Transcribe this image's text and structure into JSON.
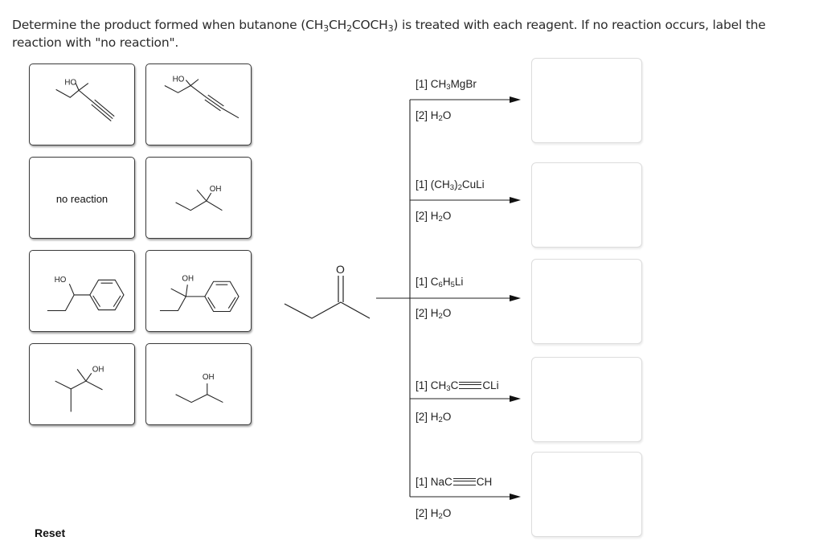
{
  "instructions": {
    "part1": "Determine the product formed when butanone (CH",
    "sub1": "3",
    "part2": "CH",
    "sub2": "2",
    "part3": "COCH",
    "sub3": "3",
    "part4": ") is treated with each reagent.  If no reaction occurs, label the reaction with \"no reaction\"."
  },
  "answer_cards": [
    {
      "id": "3-methylpent-1-yn-3-ol",
      "label": "HO"
    },
    {
      "id": "3-methylhex-4-yn-3-ol",
      "label": "HO"
    },
    {
      "id": "no-reaction",
      "label": "no reaction"
    },
    {
      "id": "2-methylbutan-2-ol",
      "label": "OH"
    },
    {
      "id": "1-phenylpropan-1-ol",
      "label": "HO"
    },
    {
      "id": "2-phenylbutan-2-ol",
      "label": "OH"
    },
    {
      "id": "2,3-dimethylbutan-2-ol",
      "label": "OH"
    },
    {
      "id": "butan-2-ol",
      "label": "OH"
    }
  ],
  "starting_material": {
    "name": "butanone",
    "atom_label": "O"
  },
  "reactions": [
    {
      "step1_prefix": "[1] CH",
      "step1_sub": "3",
      "step1_suffix": "MgBr",
      "step2_prefix": "[2] H",
      "step2_sub": "2",
      "step2_suffix": "O"
    },
    {
      "step1_prefix": "[1] (CH",
      "step1_sub": "3",
      "step1_suffix": ")",
      "step1_sub2": "2",
      "step1_suffix2": "CuLi",
      "step2_prefix": "[2] H",
      "step2_sub": "2",
      "step2_suffix": "O"
    },
    {
      "step1_prefix": "[1] C",
      "step1_sub": "6",
      "step1_suffix": "H",
      "step1_sub2": "5",
      "step1_suffix2": "Li",
      "step2_prefix": "[2] H",
      "step2_sub": "2",
      "step2_suffix": "O"
    },
    {
      "step1_prefix": "[1] CH",
      "step1_sub": "3",
      "step1_suffix": "C",
      "step1_triple_after": "CLi",
      "step2_prefix": "[2] H",
      "step2_sub": "2",
      "step2_suffix": "O"
    },
    {
      "step1_prefix": "[1] NaC",
      "step1_triple_after": "CH",
      "step2_prefix": "[2] H",
      "step2_sub": "2",
      "step2_suffix": "O"
    }
  ],
  "dropzones": [
    {
      "reaction": 1,
      "value": ""
    },
    {
      "reaction": 2,
      "value": ""
    },
    {
      "reaction": 3,
      "value": ""
    },
    {
      "reaction": 4,
      "value": ""
    },
    {
      "reaction": 5,
      "value": ""
    }
  ],
  "reset_label": "Reset"
}
